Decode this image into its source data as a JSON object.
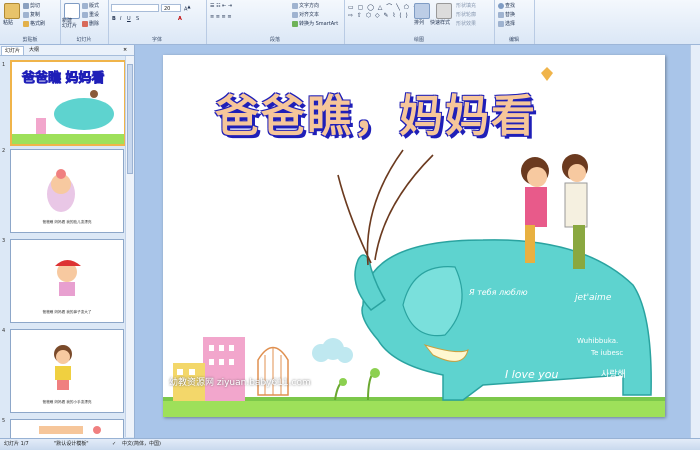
{
  "ribbon": {
    "clipboard": {
      "paste": "粘贴",
      "cut": "剪切",
      "copy": "复制",
      "format_painter": "格式刷",
      "group": "剪贴板"
    },
    "slides": {
      "new_slide": "新建\n幻灯片",
      "layout": "版式",
      "reset": "重设",
      "delete": "删除",
      "group": "幻灯片"
    },
    "font": {
      "size": "20",
      "group": "字体"
    },
    "paragraph": {
      "text_direction": "文字方向",
      "align_text": "对齐文本",
      "smartart": "转换为 SmartArt",
      "group": "段落"
    },
    "drawing": {
      "arrange": "排列",
      "quick_styles": "快速样式",
      "shape_fill": "形状填充",
      "shape_outline": "形状轮廓",
      "shape_effects": "形状效果",
      "group": "绘图"
    },
    "editing": {
      "find": "查找",
      "replace": "替换",
      "select": "选择",
      "group": "编辑"
    }
  },
  "panel": {
    "tab_slides": "幻灯片",
    "tab_outline": "大纲"
  },
  "thumbnails": [
    {
      "num": "1",
      "caption": ""
    },
    {
      "num": "2",
      "caption": "爸爸瞧 妈妈看 我的脸儿变漂亮"
    },
    {
      "num": "3",
      "caption": "爸爸瞧 妈妈看 我的鼻子变大了"
    },
    {
      "num": "4",
      "caption": "爸爸瞧 妈妈看 我的小手变漂亮"
    },
    {
      "num": "5",
      "caption": ""
    }
  ],
  "slide": {
    "title": "爸爸瞧，妈妈看",
    "watermark": "幼教资源网 ziyuan.baby611.com",
    "elephant_text": {
      "line1": "I love you",
      "line2": "사랑해",
      "line3": "Wuhibbuka.",
      "line4": "Te iubesc",
      "line5": "jet'aime",
      "line6": "Я тебя люблю"
    }
  },
  "status": {
    "slide_count": "幻灯片 1/7",
    "theme": "\"默认设计模板\"",
    "language": "中文(简体，中国)"
  },
  "colors": {
    "ribbon_bg": "#dbe7f6",
    "workspace": "#a9c5e9",
    "title_fill": "#f6c69a",
    "title_shadow": "#1f1fb8",
    "elephant": "#5ed3cf",
    "grass": "#9ee05a"
  }
}
